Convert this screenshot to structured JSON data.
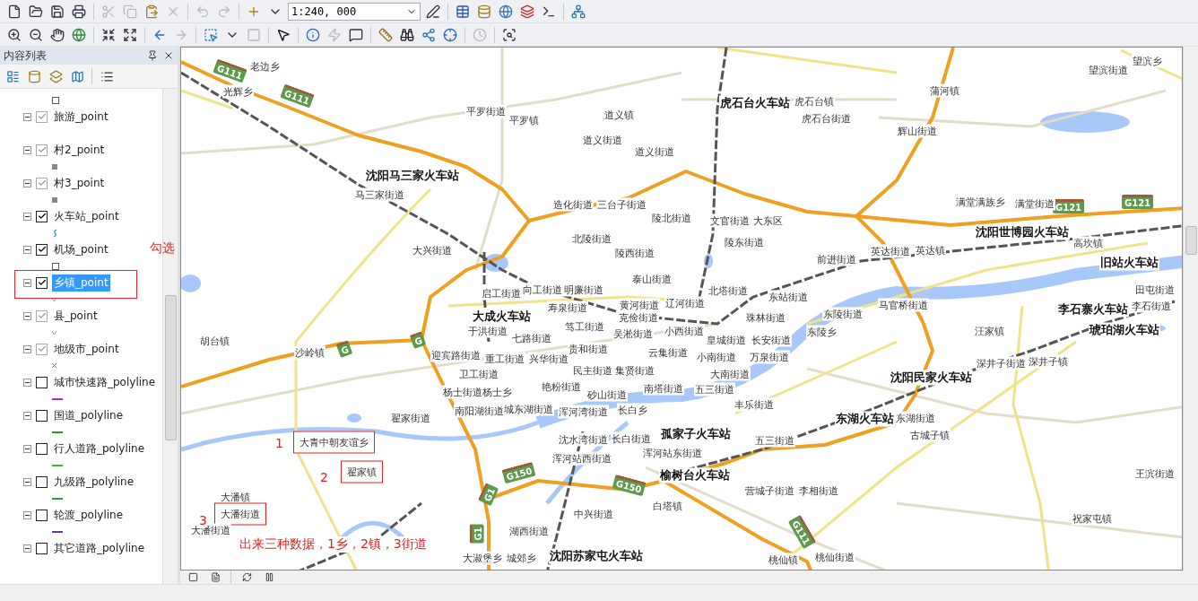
{
  "toolbar": {
    "scale": "1:240, 000"
  },
  "toc": {
    "title": "内容列表",
    "layers": [
      {
        "name": "旅游_point",
        "checked": true,
        "dimmed": true,
        "selected": false,
        "boxed": false,
        "kind": "none"
      },
      {
        "name": "村2_point",
        "checked": true,
        "dimmed": true,
        "selected": false,
        "boxed": false,
        "kind": "square"
      },
      {
        "name": "村3_point",
        "checked": true,
        "dimmed": true,
        "selected": false,
        "boxed": false,
        "kind": "square"
      },
      {
        "name": "火车站_point",
        "checked": true,
        "dimmed": false,
        "selected": false,
        "boxed": false,
        "kind": "station"
      },
      {
        "name": "机场_point",
        "checked": true,
        "dimmed": false,
        "selected": false,
        "boxed": false,
        "kind": "outline"
      },
      {
        "name": "乡镇_point",
        "checked": true,
        "dimmed": false,
        "selected": true,
        "boxed": true,
        "kind": "tick"
      },
      {
        "name": "县_point",
        "checked": true,
        "dimmed": true,
        "selected": false,
        "boxed": false,
        "kind": "tick"
      },
      {
        "name": "地级市_point",
        "checked": true,
        "dimmed": true,
        "selected": false,
        "boxed": false,
        "kind": "cross"
      },
      {
        "name": "城市快速路_polyline",
        "checked": false,
        "dimmed": false,
        "selected": false,
        "boxed": false,
        "kind": "line",
        "color": "#b030b0"
      },
      {
        "name": "国道_polyline",
        "checked": false,
        "dimmed": false,
        "selected": false,
        "boxed": false,
        "kind": "line",
        "color": "#2e9a2e"
      },
      {
        "name": "行人道路_polyline",
        "checked": false,
        "dimmed": false,
        "selected": false,
        "boxed": false,
        "kind": "line",
        "color": "#48b020"
      },
      {
        "name": "九级路_polyline",
        "checked": false,
        "dimmed": false,
        "selected": false,
        "boxed": false,
        "kind": "line",
        "color": "#3a9a3a"
      },
      {
        "name": "轮渡_polyline",
        "checked": false,
        "dimmed": false,
        "selected": false,
        "boxed": false,
        "kind": "line",
        "color": "#7030a0"
      },
      {
        "name": "其它道路_polyline",
        "checked": false,
        "dimmed": false,
        "selected": false,
        "boxed": false,
        "kind": "none"
      }
    ]
  },
  "map": {
    "labels": [
      {
        "text": "老边乡",
        "kind": "place",
        "boxed": false
      },
      {
        "text": "光辉乡",
        "kind": "place",
        "boxed": false
      },
      {
        "text": "平罗街道",
        "kind": "place",
        "boxed": false
      },
      {
        "text": "平罗镇",
        "kind": "place",
        "boxed": false
      },
      {
        "text": "道义镇",
        "kind": "place",
        "boxed": false
      },
      {
        "text": "道义街道",
        "kind": "place",
        "boxed": false
      },
      {
        "text": "道义街道",
        "kind": "place",
        "boxed": false
      },
      {
        "text": "虎石台火车站",
        "kind": "station",
        "boxed": false
      },
      {
        "text": "虎石台镇",
        "kind": "place",
        "boxed": false
      },
      {
        "text": "虎石台街道",
        "kind": "place",
        "boxed": false
      },
      {
        "text": "蒲河镇",
        "kind": "place",
        "boxed": false
      },
      {
        "text": "辉山街道",
        "kind": "place",
        "boxed": false
      },
      {
        "text": "望滨街道",
        "kind": "place",
        "boxed": false
      },
      {
        "text": "望滨乡",
        "kind": "place",
        "boxed": false
      },
      {
        "text": "沈阳马三家火车站",
        "kind": "station",
        "boxed": false
      },
      {
        "text": "马三家街道",
        "kind": "place",
        "boxed": false
      },
      {
        "text": "造化街道",
        "kind": "place",
        "boxed": false
      },
      {
        "text": "三台子街道",
        "kind": "place",
        "boxed": false
      },
      {
        "text": "陵北街道",
        "kind": "place",
        "boxed": false
      },
      {
        "text": "文官街道",
        "kind": "place",
        "boxed": false
      },
      {
        "text": "大东区",
        "kind": "place",
        "boxed": false
      },
      {
        "text": "满堂满族乡",
        "kind": "place",
        "boxed": false
      },
      {
        "text": "满堂街道",
        "kind": "place",
        "boxed": false
      },
      {
        "text": "北陵街道",
        "kind": "place",
        "boxed": false
      },
      {
        "text": "陵东街道",
        "kind": "place",
        "boxed": false
      },
      {
        "text": "沈阳世博园火车站",
        "kind": "station",
        "boxed": false
      },
      {
        "text": "高坎镇",
        "kind": "place",
        "boxed": false
      },
      {
        "text": "大兴街道",
        "kind": "place",
        "boxed": false
      },
      {
        "text": "陵西街道",
        "kind": "place",
        "boxed": false
      },
      {
        "text": "英达街道",
        "kind": "place",
        "boxed": false
      },
      {
        "text": "英达镇",
        "kind": "place",
        "boxed": false
      },
      {
        "text": "前进街道",
        "kind": "place",
        "boxed": false
      },
      {
        "text": "旧站火车站",
        "kind": "station",
        "boxed": false
      },
      {
        "text": "泰山街道",
        "kind": "place",
        "boxed": false
      },
      {
        "text": "启工街道",
        "kind": "place",
        "boxed": false
      },
      {
        "text": "向工街道",
        "kind": "place",
        "boxed": false
      },
      {
        "text": "明廉街道",
        "kind": "place",
        "boxed": false
      },
      {
        "text": "北塔街道",
        "kind": "place",
        "boxed": false
      },
      {
        "text": "东站街道",
        "kind": "place",
        "boxed": false
      },
      {
        "text": "田屯街道",
        "kind": "place",
        "boxed": false
      },
      {
        "text": "寿泉街道",
        "kind": "place",
        "boxed": false
      },
      {
        "text": "黄河街道",
        "kind": "place",
        "boxed": false
      },
      {
        "text": "辽河街道",
        "kind": "place",
        "boxed": false
      },
      {
        "text": "马官桥街道",
        "kind": "place",
        "boxed": false
      },
      {
        "text": "李石寨火车站",
        "kind": "station",
        "boxed": false
      },
      {
        "text": "李石街道",
        "kind": "place",
        "boxed": false
      },
      {
        "text": "大成火车站",
        "kind": "station",
        "boxed": false
      },
      {
        "text": "克俭街道",
        "kind": "place",
        "boxed": false
      },
      {
        "text": "珠林街道",
        "kind": "place",
        "boxed": false
      },
      {
        "text": "东陵街道",
        "kind": "place",
        "boxed": false
      },
      {
        "text": "于洪街道",
        "kind": "place",
        "boxed": false
      },
      {
        "text": "笃工街道",
        "kind": "place",
        "boxed": false
      },
      {
        "text": "琥珀湖火车站",
        "kind": "station",
        "boxed": false
      },
      {
        "text": "七路街道",
        "kind": "place",
        "boxed": false
      },
      {
        "text": "吴淞街道",
        "kind": "place",
        "boxed": false
      },
      {
        "text": "小西街道",
        "kind": "place",
        "boxed": false
      },
      {
        "text": "东陵乡",
        "kind": "place",
        "boxed": false
      },
      {
        "text": "汪家镇",
        "kind": "place",
        "boxed": false
      },
      {
        "text": "胡台镇",
        "kind": "place",
        "boxed": false
      },
      {
        "text": "皇城街道",
        "kind": "place",
        "boxed": false
      },
      {
        "text": "长安街道",
        "kind": "place",
        "boxed": false
      },
      {
        "text": "沙岭镇",
        "kind": "place",
        "boxed": false
      },
      {
        "text": "贵和街道",
        "kind": "place",
        "boxed": false
      },
      {
        "text": "迎宾路街道",
        "kind": "place",
        "boxed": false
      },
      {
        "text": "重工街道",
        "kind": "place",
        "boxed": false
      },
      {
        "text": "兴华街道",
        "kind": "place",
        "boxed": false
      },
      {
        "text": "云集街道",
        "kind": "place",
        "boxed": false
      },
      {
        "text": "小南街道",
        "kind": "place",
        "boxed": false
      },
      {
        "text": "万泉街道",
        "kind": "place",
        "boxed": false
      },
      {
        "text": "深井子街道",
        "kind": "place",
        "boxed": false
      },
      {
        "text": "深井子镇",
        "kind": "place",
        "boxed": false
      },
      {
        "text": "卫工街道",
        "kind": "place",
        "boxed": false
      },
      {
        "text": "民主街道",
        "kind": "place",
        "boxed": false
      },
      {
        "text": "集贤街道",
        "kind": "place",
        "boxed": false
      },
      {
        "text": "大南街道",
        "kind": "place",
        "boxed": false
      },
      {
        "text": "沈阳民家火车站",
        "kind": "station",
        "boxed": false
      },
      {
        "text": "杨士街道",
        "kind": "place",
        "boxed": false
      },
      {
        "text": "杨士乡",
        "kind": "place",
        "boxed": false
      },
      {
        "text": "艳粉街道",
        "kind": "place",
        "boxed": false
      },
      {
        "text": "砂山街道",
        "kind": "place",
        "boxed": false
      },
      {
        "text": "南塔街道",
        "kind": "place",
        "boxed": false
      },
      {
        "text": "五三街道",
        "kind": "place",
        "boxed": false
      },
      {
        "text": "丰乐街道",
        "kind": "place",
        "boxed": false
      },
      {
        "text": "南阳湖街道",
        "kind": "place",
        "boxed": false
      },
      {
        "text": "城东湖街道",
        "kind": "place",
        "boxed": false
      },
      {
        "text": "浑河湾街道",
        "kind": "place",
        "boxed": false
      },
      {
        "text": "长白乡",
        "kind": "place",
        "boxed": false
      },
      {
        "text": "翟家街道",
        "kind": "place",
        "boxed": false
      },
      {
        "text": "东湖火车站",
        "kind": "station",
        "boxed": false
      },
      {
        "text": "东湖街道",
        "kind": "place",
        "boxed": false
      },
      {
        "text": "孤家子火车站",
        "kind": "station",
        "boxed": false
      },
      {
        "text": "古城子镇",
        "kind": "place",
        "boxed": false
      },
      {
        "text": "大青中朝友谊乡",
        "kind": "place",
        "boxed": true
      },
      {
        "text": "沈水湾街道",
        "kind": "place",
        "boxed": false
      },
      {
        "text": "长白街道",
        "kind": "place",
        "boxed": false
      },
      {
        "text": "五三街道",
        "kind": "place",
        "boxed": false
      },
      {
        "text": "浑河站东街道",
        "kind": "place",
        "boxed": false
      },
      {
        "text": "浑河站西街道",
        "kind": "place",
        "boxed": false
      },
      {
        "text": "翟家镇",
        "kind": "place",
        "boxed": true
      },
      {
        "text": "榆树台火车站",
        "kind": "station",
        "boxed": false
      },
      {
        "text": "王滨街道",
        "kind": "place",
        "boxed": false
      },
      {
        "text": "大潘镇",
        "kind": "place",
        "boxed": false
      },
      {
        "text": "营城子街道",
        "kind": "place",
        "boxed": false
      },
      {
        "text": "李相街道",
        "kind": "place",
        "boxed": false
      },
      {
        "text": "大潘街道",
        "kind": "place",
        "boxed": true
      },
      {
        "text": "白塔镇",
        "kind": "place",
        "boxed": false
      },
      {
        "text": "大潘街道",
        "kind": "place",
        "boxed": false
      },
      {
        "text": "中兴街道",
        "kind": "place",
        "boxed": false
      },
      {
        "text": "湖西街道",
        "kind": "place",
        "boxed": false
      },
      {
        "text": "祝家屯镇",
        "kind": "place",
        "boxed": false
      },
      {
        "text": "大淑堡乡",
        "kind": "place",
        "boxed": false
      },
      {
        "text": "城郊乡",
        "kind": "place",
        "boxed": false
      },
      {
        "text": "沈阳苏家屯火车站",
        "kind": "station",
        "boxed": false
      },
      {
        "text": "桃仙镇",
        "kind": "place",
        "boxed": false
      },
      {
        "text": "桃仙街道",
        "kind": "place",
        "boxed": false
      }
    ],
    "shields": [
      "G111",
      "G111",
      "G121",
      "G121",
      "G",
      "G",
      "G150",
      "G1",
      "G150",
      "G1",
      "G111"
    ],
    "notes": [
      "勾选",
      "1",
      "2",
      "3",
      "出来三种数据，1乡，2镇，3街道"
    ]
  }
}
